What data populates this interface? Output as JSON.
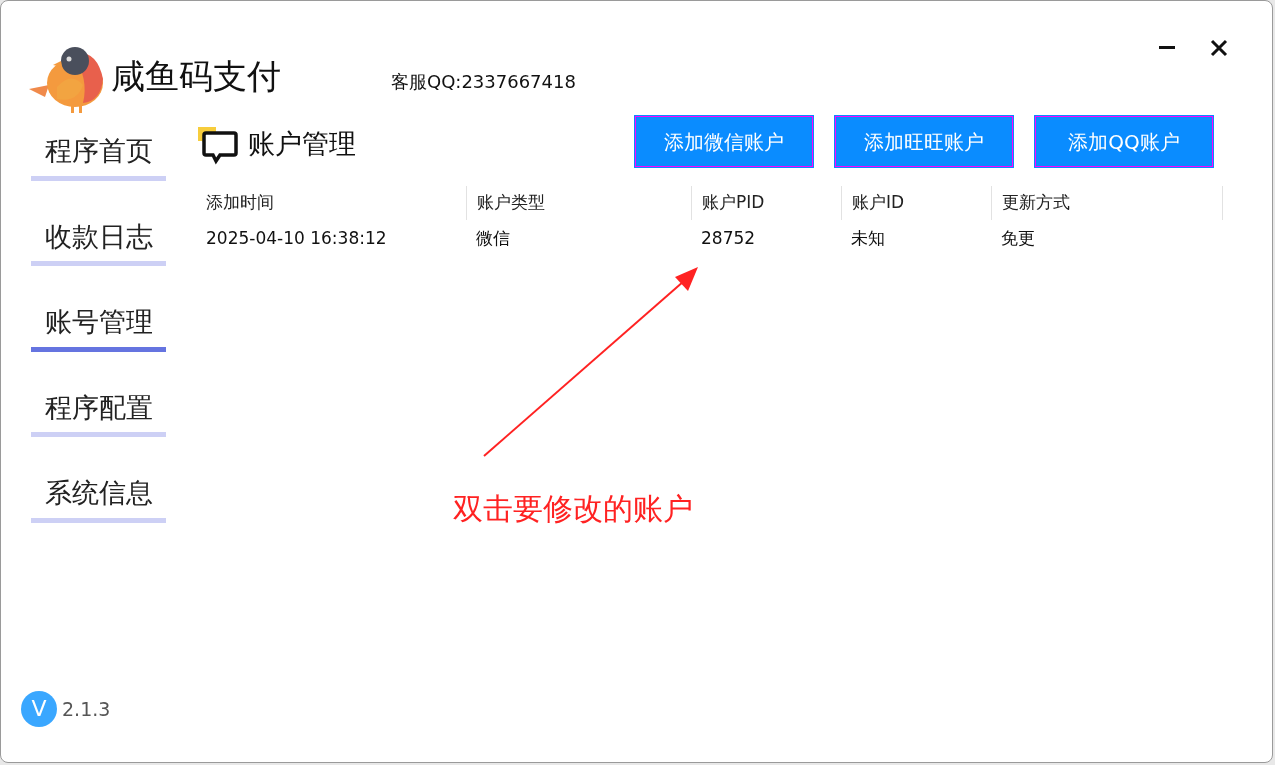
{
  "app": {
    "title": "咸鱼码支付",
    "support": "客服QQ:2337667418"
  },
  "sidebar": {
    "items": [
      {
        "label": "程序首页",
        "selected": false
      },
      {
        "label": "收款日志",
        "selected": false
      },
      {
        "label": "账号管理",
        "selected": true
      },
      {
        "label": "程序配置",
        "selected": false
      },
      {
        "label": "系统信息",
        "selected": false
      }
    ]
  },
  "page": {
    "title": "账户管理"
  },
  "buttons": [
    "添加微信账户",
    "添加旺旺账户",
    "添加QQ账户"
  ],
  "table": {
    "columns": [
      "添加时间",
      "账户类型",
      "账户PID",
      "账户ID",
      "更新方式"
    ],
    "rows": [
      [
        "2025-04-10 16:38:12",
        "微信",
        "28752",
        "未知",
        "免更"
      ]
    ]
  },
  "annotation": {
    "text": "双击要修改的账户"
  },
  "version": {
    "badge": "V",
    "number": "2.1.3"
  }
}
